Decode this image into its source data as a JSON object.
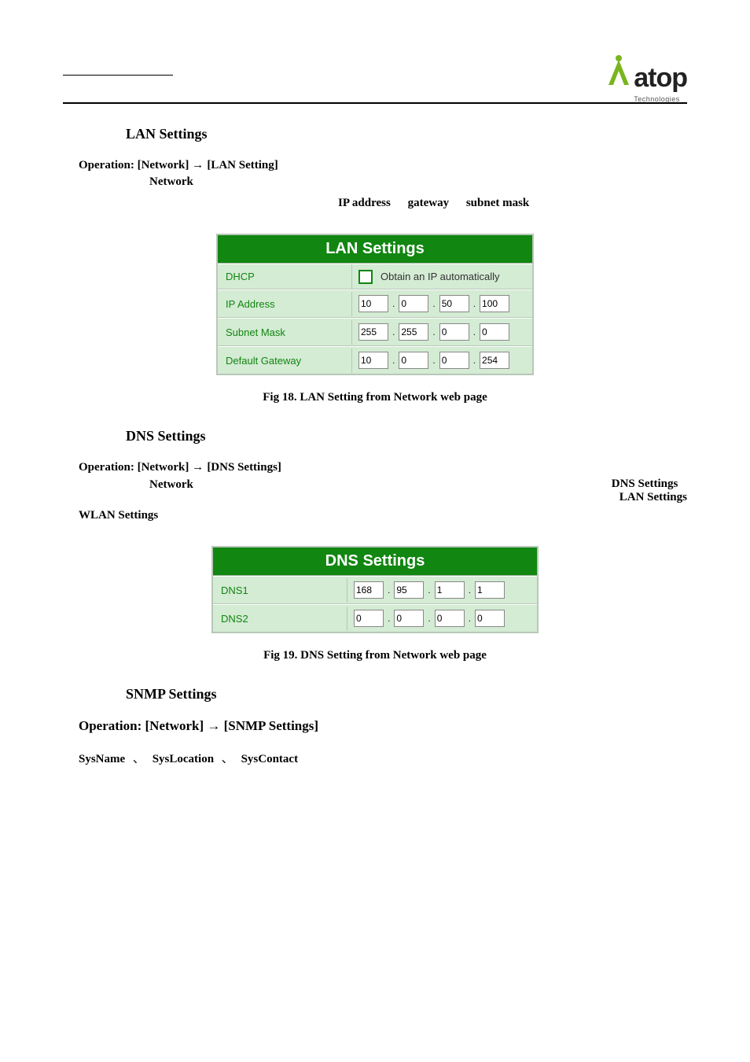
{
  "logo": {
    "word": "atop",
    "sub": "Technologies"
  },
  "sections": {
    "lan": {
      "heading": "LAN Settings",
      "op_prefix": "Operation: [Network]",
      "op_target": "[LAN Setting]",
      "sub": "Network",
      "labels": {
        "ip": "IP address",
        "gw": "gateway",
        "sn": "subnet mask"
      },
      "panel": {
        "title": "LAN Settings",
        "rows": {
          "dhcp": {
            "label": "DHCP",
            "text": "Obtain an IP automatically",
            "checked": false
          },
          "ip": {
            "label": "IP Address",
            "o": [
              "10",
              "0",
              "50",
              "100"
            ]
          },
          "sn": {
            "label": "Subnet Mask",
            "o": [
              "255",
              "255",
              "0",
              "0"
            ]
          },
          "gw": {
            "label": "Default Gateway",
            "o": [
              "10",
              "0",
              "0",
              "254"
            ]
          }
        }
      },
      "caption": "Fig 18. LAN Setting from Network web page"
    },
    "dns": {
      "heading": "DNS Settings",
      "op_prefix": "Operation: [Network]",
      "op_target": "[DNS Settings]",
      "sub": "Network",
      "right1": "DNS Settings",
      "right2": "LAN  Settings",
      "wlan": "WLAN Settings",
      "panel": {
        "title": "DNS Settings",
        "rows": {
          "d1": {
            "label": "DNS1",
            "o": [
              "168",
              "95",
              "1",
              "1"
            ]
          },
          "d2": {
            "label": "DNS2",
            "o": [
              "0",
              "0",
              "0",
              "0"
            ]
          }
        }
      },
      "caption": "Fig 19. DNS Setting from Network web page"
    },
    "snmp": {
      "heading": "SNMP Settings",
      "op_prefix": "Operation: [Network]",
      "op_target": "[SNMP Settings]",
      "sys": {
        "a": "SysName",
        "b": "SysLocation",
        "c": "SysContact",
        "sep": "、"
      }
    }
  }
}
